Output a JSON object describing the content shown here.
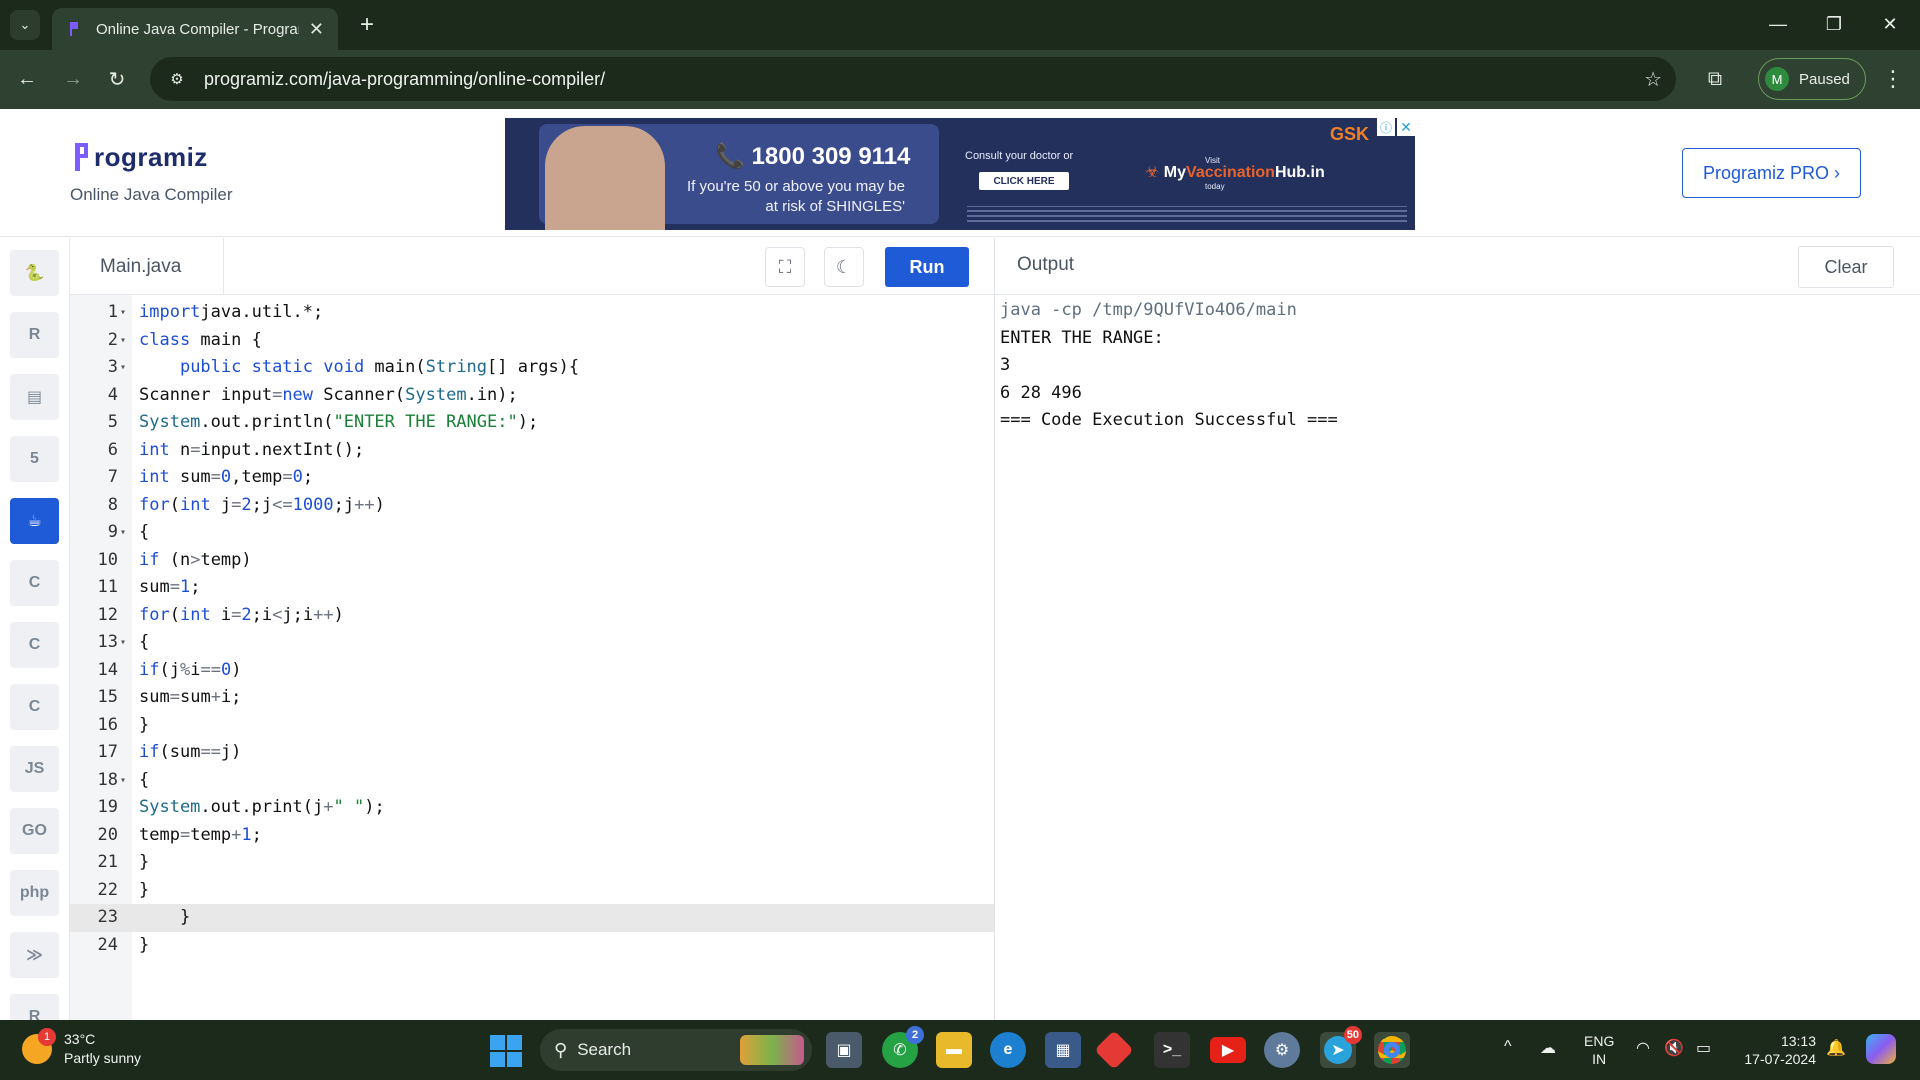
{
  "browser": {
    "tab_title": "Online Java Compiler - Programiz",
    "url": "programiz.com/java-programming/online-compiler/",
    "profile_initial": "M",
    "profile_status": "Paused",
    "accent": "#2f4130"
  },
  "site": {
    "logo_text": "rogramiz",
    "subtitle": "Online Java Compiler",
    "pro_button": "Programiz PRO ›",
    "brand_color": "#1f5bd7"
  },
  "ad": {
    "phone": "📞 1800 309 9114",
    "line1": "If you're 50 or above you may be",
    "line2": "at risk of SHINGLES'",
    "consult": "Consult your doctor or",
    "cta": "CLICK HERE",
    "brand_prefix": "My",
    "brand_highlight": "Vaccination",
    "brand_suffix": "Hub.in",
    "brand_top": "Visit",
    "brand_bottom": "today",
    "sponsor": "GSK"
  },
  "sidebar": {
    "items": [
      {
        "name": "python",
        "label": "🐍"
      },
      {
        "name": "r",
        "label": "R"
      },
      {
        "name": "sql",
        "label": "▤"
      },
      {
        "name": "html",
        "label": "5"
      },
      {
        "name": "java",
        "label": "☕",
        "active": true
      },
      {
        "name": "c",
        "label": "C"
      },
      {
        "name": "cpp",
        "label": "C"
      },
      {
        "name": "csharp",
        "label": "C"
      },
      {
        "name": "js",
        "label": "JS"
      },
      {
        "name": "go",
        "label": "GO"
      },
      {
        "name": "php",
        "label": "php"
      },
      {
        "name": "swift",
        "label": "≫"
      },
      {
        "name": "rust",
        "label": "R"
      }
    ]
  },
  "editor": {
    "filename": "Main.java",
    "run_label": "Run",
    "highlighted_line": 23,
    "lines": [
      {
        "n": "1",
        "fold": true,
        "code": [
          [
            "kw",
            "import"
          ],
          [
            "",
            "java.util.*;"
          ]
        ]
      },
      {
        "n": "2",
        "fold": true,
        "code": [
          [
            "kw",
            "class"
          ],
          [
            "",
            " main {"
          ]
        ]
      },
      {
        "n": "3",
        "fold": true,
        "code": [
          [
            "",
            "    "
          ],
          [
            "kw",
            "public static void"
          ],
          [
            "",
            " main("
          ],
          [
            "cls",
            "String"
          ],
          [
            "",
            "[] args){"
          ]
        ]
      },
      {
        "n": "4",
        "fold": false,
        "code": [
          [
            "",
            "Scanner input"
          ],
          [
            "op",
            "="
          ],
          [
            "kw",
            "new"
          ],
          [
            "",
            " Scanner("
          ],
          [
            "cls",
            "System"
          ],
          [
            "",
            ".in);"
          ]
        ]
      },
      {
        "n": "5",
        "fold": false,
        "code": [
          [
            "cls",
            "System"
          ],
          [
            "",
            ".out.println("
          ],
          [
            "str",
            "\"ENTER THE RANGE:\""
          ],
          [
            "",
            ");"
          ]
        ]
      },
      {
        "n": "6",
        "fold": false,
        "code": [
          [
            "kw",
            "int"
          ],
          [
            "",
            " n"
          ],
          [
            "op",
            "="
          ],
          [
            "",
            "input.nextInt();"
          ]
        ]
      },
      {
        "n": "7",
        "fold": false,
        "code": [
          [
            "kw",
            "int"
          ],
          [
            "",
            " sum"
          ],
          [
            "op",
            "="
          ],
          [
            "kw",
            "0"
          ],
          [
            "",
            ",temp"
          ],
          [
            "op",
            "="
          ],
          [
            "kw",
            "0"
          ],
          [
            "",
            ";"
          ]
        ]
      },
      {
        "n": "8",
        "fold": false,
        "code": [
          [
            "kw",
            "for"
          ],
          [
            "",
            "("
          ],
          [
            "kw",
            "int"
          ],
          [
            "",
            " j"
          ],
          [
            "op",
            "="
          ],
          [
            "kw",
            "2"
          ],
          [
            "",
            ";j"
          ],
          [
            "op",
            "<="
          ],
          [
            "kw",
            "1000"
          ],
          [
            "",
            ";j"
          ],
          [
            "op",
            "++"
          ],
          [
            "",
            ")"
          ]
        ]
      },
      {
        "n": "9",
        "fold": true,
        "code": [
          [
            "",
            "{"
          ]
        ]
      },
      {
        "n": "10",
        "fold": false,
        "code": [
          [
            "kw",
            "if"
          ],
          [
            "",
            " (n"
          ],
          [
            "op",
            ">"
          ],
          [
            "",
            "temp)"
          ]
        ]
      },
      {
        "n": "11",
        "fold": false,
        "code": [
          [
            "",
            "sum"
          ],
          [
            "op",
            "="
          ],
          [
            "kw",
            "1"
          ],
          [
            "",
            ";"
          ]
        ]
      },
      {
        "n": "12",
        "fold": false,
        "code": [
          [
            "kw",
            "for"
          ],
          [
            "",
            "("
          ],
          [
            "kw",
            "int"
          ],
          [
            "",
            " i"
          ],
          [
            "op",
            "="
          ],
          [
            "kw",
            "2"
          ],
          [
            "",
            ";i"
          ],
          [
            "op",
            "<"
          ],
          [
            "",
            "j;i"
          ],
          [
            "op",
            "++"
          ],
          [
            "",
            ")"
          ]
        ]
      },
      {
        "n": "13",
        "fold": true,
        "code": [
          [
            "",
            "{"
          ]
        ]
      },
      {
        "n": "14",
        "fold": false,
        "code": [
          [
            "kw",
            "if"
          ],
          [
            "",
            "(j"
          ],
          [
            "op",
            "%"
          ],
          [
            "",
            "i"
          ],
          [
            "op",
            "=="
          ],
          [
            "kw",
            "0"
          ],
          [
            "",
            ")"
          ]
        ]
      },
      {
        "n": "15",
        "fold": false,
        "code": [
          [
            "",
            "sum"
          ],
          [
            "op",
            "="
          ],
          [
            "",
            "sum"
          ],
          [
            "op",
            "+"
          ],
          [
            "",
            "i;"
          ]
        ]
      },
      {
        "n": "16",
        "fold": false,
        "code": [
          [
            "",
            "}"
          ]
        ]
      },
      {
        "n": "17",
        "fold": false,
        "code": [
          [
            "kw",
            "if"
          ],
          [
            "",
            "(sum"
          ],
          [
            "op",
            "=="
          ],
          [
            "",
            "j)"
          ]
        ]
      },
      {
        "n": "18",
        "fold": true,
        "code": [
          [
            "",
            "{"
          ]
        ]
      },
      {
        "n": "19",
        "fold": false,
        "code": [
          [
            "cls",
            "System"
          ],
          [
            "",
            ".out.print(j"
          ],
          [
            "op",
            "+"
          ],
          [
            "str",
            "\" \""
          ],
          [
            "",
            ");"
          ]
        ]
      },
      {
        "n": "20",
        "fold": false,
        "code": [
          [
            "",
            "temp"
          ],
          [
            "op",
            "="
          ],
          [
            "",
            "temp"
          ],
          [
            "op",
            "+"
          ],
          [
            "kw",
            "1"
          ],
          [
            "",
            ";"
          ]
        ]
      },
      {
        "n": "21",
        "fold": false,
        "code": [
          [
            "",
            "}"
          ]
        ]
      },
      {
        "n": "22",
        "fold": false,
        "code": [
          [
            "",
            "}"
          ]
        ]
      },
      {
        "n": "23",
        "fold": false,
        "code": [
          [
            "",
            "    }"
          ]
        ]
      },
      {
        "n": "24",
        "fold": false,
        "code": [
          [
            "",
            "}"
          ]
        ]
      }
    ]
  },
  "output": {
    "title": "Output",
    "clear_label": "Clear",
    "lines": [
      {
        "text": "java -cp /tmp/9QUfVIo4O6/main",
        "cmd": true
      },
      {
        "text": "ENTER THE RANGE:",
        "cmd": false
      },
      {
        "text": "3",
        "cmd": false
      },
      {
        "text": "6 28 496",
        "cmd": false
      },
      {
        "text": "=== Code Execution Successful ===",
        "cmd": false
      }
    ]
  },
  "taskbar": {
    "weather_temp": "33°C",
    "weather_desc": "Partly sunny",
    "weather_badge": "1",
    "search_label": "Search",
    "whatsapp_badge": "2",
    "telegram_badge": "50",
    "lang_line1": "ENG",
    "lang_line2": "IN",
    "time": "13:13",
    "date": "17-07-2024"
  }
}
